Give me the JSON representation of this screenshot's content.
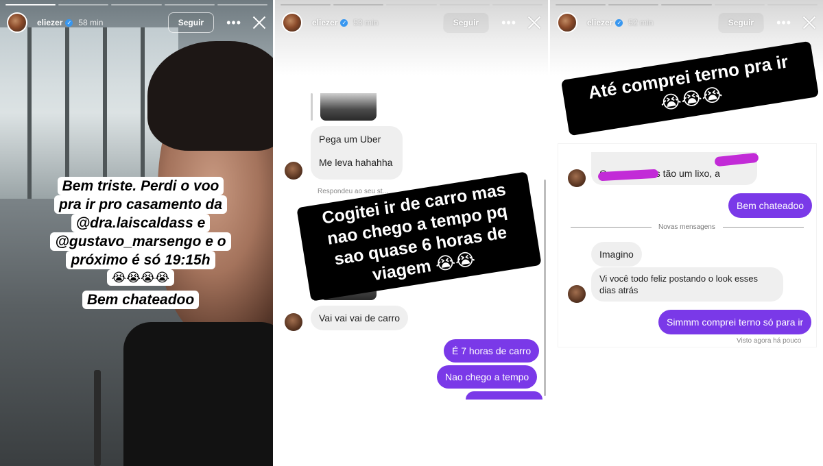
{
  "stories": [
    {
      "user": "eliezer",
      "time": "58 min",
      "follow_label": "Seguir",
      "more_label": "•••",
      "progress": {
        "segments": 5,
        "current": 1
      },
      "lines": [
        "Bem triste. Perdi o voo",
        "pra ir pro casamento da",
        "@dra.laiscaldass e",
        "@gustavo_marsengo e o",
        "próximo é só 19:15h",
        "😭😭😭😭",
        "Bem chateadoo"
      ]
    },
    {
      "user": "eliezer",
      "time": "53 min",
      "follow_label": "Seguir",
      "more_label": "•••",
      "progress": {
        "segments": 5,
        "current": 2
      },
      "messages": {
        "pega": "Pega um Uber",
        "leva": "Me leva hahahha",
        "respondeu": "Respondeu ao seu st...",
        "vai": "Vai vai vai de carro",
        "sete_horas": "É 7 horas de carro",
        "nao_chego": "Nao chego a tempo"
      },
      "sticker_lines": [
        "Cogitei ir de carro mas",
        "nao chego a tempo pq",
        "sao quase 6 horas de",
        "viagem 😭😭"
      ]
    },
    {
      "user": "eliezer",
      "time": "52 min",
      "follow_label": "Seguir",
      "more_label": "•••",
      "progress": {
        "segments": 5,
        "current": 3
      },
      "messages": {
        "aeroportos": "Os aeroportos tão um lixo, a",
        "bem_chateadoo": "Bem chateadoo",
        "novas": "Novas mensagens",
        "imagino": "Imagino",
        "vi_voce_1": "Vi você todo feliz postando o look esses",
        "vi_voce_2": "dias atrás",
        "simmm": "Simmm comprei terno só para ir",
        "visto": "Visto agora há pouco"
      },
      "sticker_lines": [
        "Até comprei terno pra ir",
        "😭😭😭"
      ]
    }
  ],
  "colors": {
    "outgoing_bubble": "#7a39e8",
    "incoming_bubble": "#efefef",
    "scribble": "#c22bd7",
    "verified": "#3897f0"
  },
  "icons": [
    "verified-badge-icon",
    "more-options-icon",
    "close-icon"
  ]
}
